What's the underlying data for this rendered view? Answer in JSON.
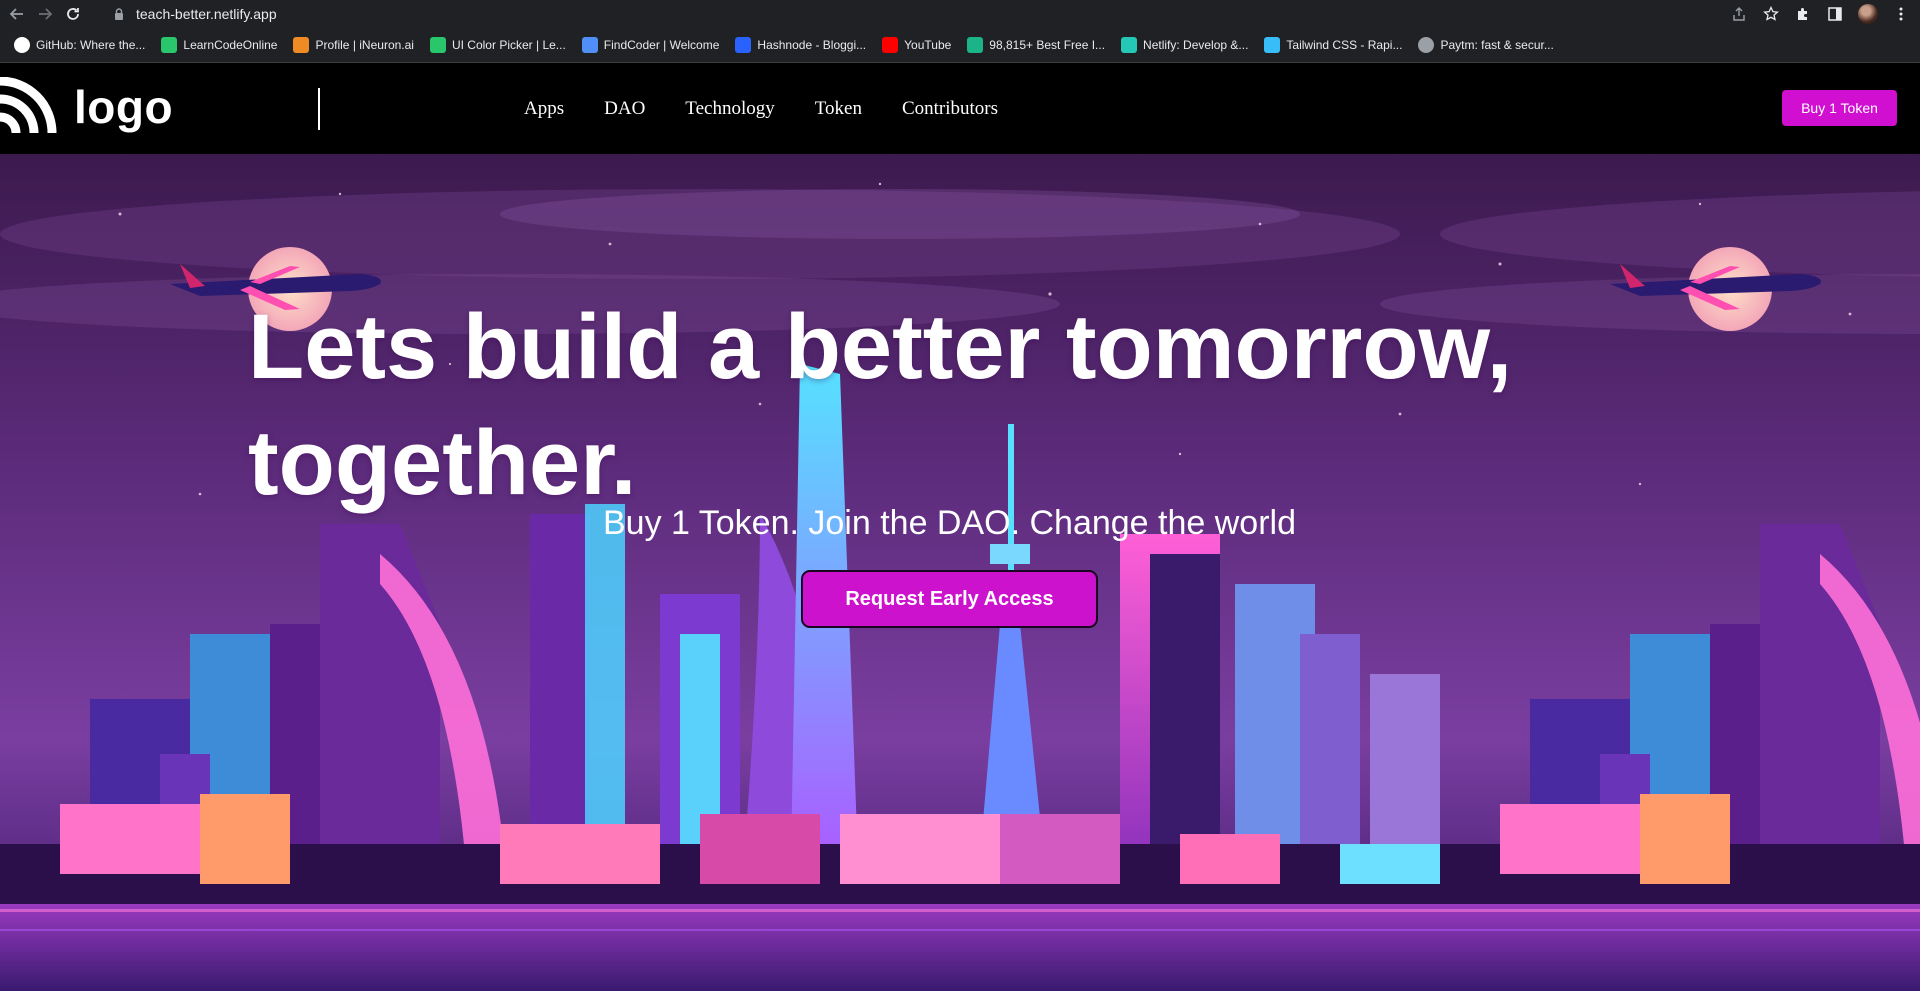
{
  "browser": {
    "url": "teach-better.netlify.app",
    "bookmarks": [
      {
        "label": "GitHub: Where the...",
        "icon": "github-icon",
        "color": "#ffffff"
      },
      {
        "label": "LearnCodeOnline",
        "icon": "learncodeonline-icon",
        "color": "#29c66b"
      },
      {
        "label": "Profile | iNeuron.ai",
        "icon": "ineuron-icon",
        "color": "#f08a24"
      },
      {
        "label": "UI Color Picker | Le...",
        "icon": "learncodeonline-icon",
        "color": "#29c66b"
      },
      {
        "label": "FindCoder | Welcome",
        "icon": "code-icon",
        "color": "#4f8ff7"
      },
      {
        "label": "Hashnode - Bloggi...",
        "icon": "hashnode-icon",
        "color": "#2962ff"
      },
      {
        "label": "YouTube",
        "icon": "youtube-icon",
        "color": "#ff0000"
      },
      {
        "label": "98,815+ Best Free I...",
        "icon": "freepik-icon",
        "color": "#1bb388"
      },
      {
        "label": "Netlify: Develop &...",
        "icon": "netlify-icon",
        "color": "#25c7b7"
      },
      {
        "label": "Tailwind CSS - Rapi...",
        "icon": "tailwind-icon",
        "color": "#38bdf8"
      },
      {
        "label": "Paytm: fast & secur...",
        "icon": "globe-icon",
        "color": "#9aa0a6"
      }
    ]
  },
  "header": {
    "logo_text": "logo",
    "nav": [
      "Apps",
      "DAO",
      "Technology",
      "Token",
      "Contributors"
    ],
    "buy_label": "Buy 1 Token",
    "accent": "#d10fd1"
  },
  "hero": {
    "title_line1": "Lets build a better tomorrow,",
    "title_line2": "together.",
    "subtitle": "Buy 1 Token. Join the DAO. Change the world",
    "cta_label": "Request Early Access",
    "cta_color": "#cc12cc"
  }
}
